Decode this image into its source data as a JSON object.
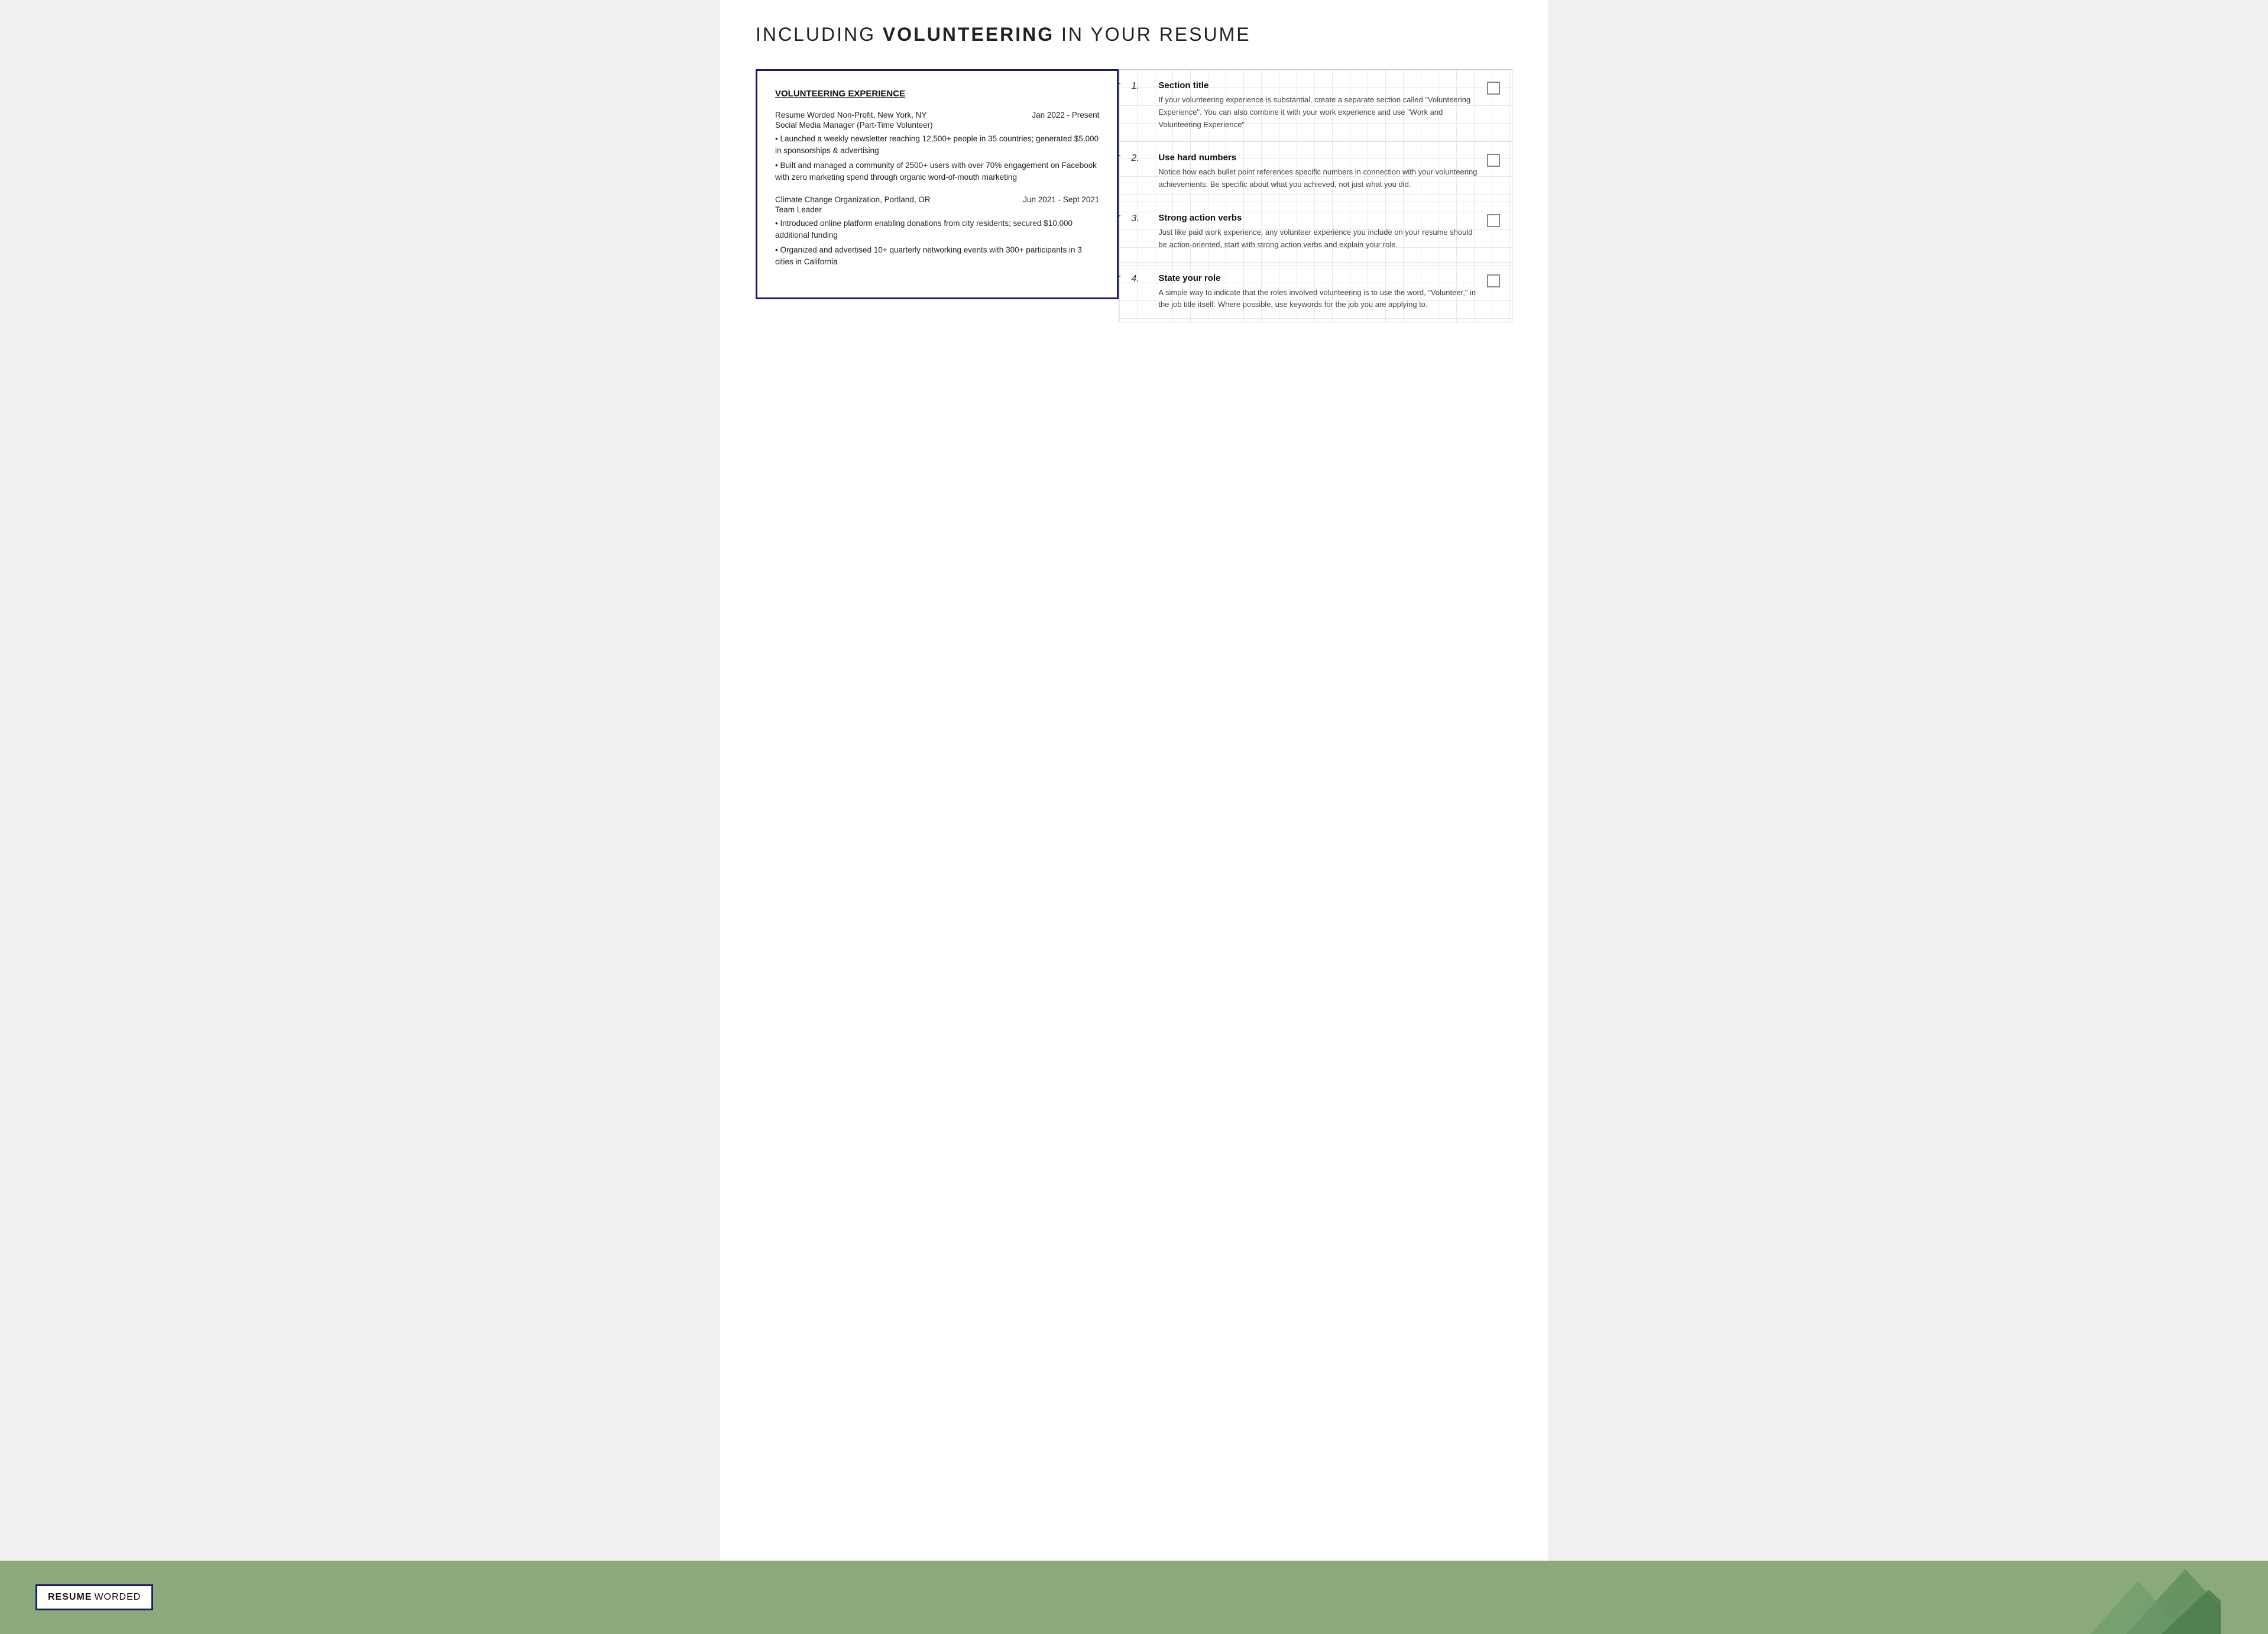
{
  "page": {
    "title_prefix": "INCLUDING ",
    "title_bold": "VOLUNTEERING",
    "title_suffix": " IN YOUR RESUME"
  },
  "resume": {
    "section_title": "VOLUNTEERING EXPERIENCE",
    "entries": [
      {
        "org": "Resume Worded Non-Profit, New York, NY",
        "dates": "Jan 2022 - Present",
        "role": "Social Media Manager (Part-Time Volunteer)",
        "bullets": [
          "• Launched a weekly newsletter reaching 12,500+ people in 35 countries; generated $5,000 in sponsorships & advertising",
          "• Built and managed a community of 2500+ users with over 70% engagement on Facebook with zero marketing spend through organic word-of-mouth marketing"
        ]
      },
      {
        "org": "Climate Change Organization, Portland, OR",
        "dates": "Jun 2021 - Sept 2021",
        "role": "Team Leader",
        "bullets": [
          "• Introduced online platform enabling donations from city residents; secured $10,000 additional funding",
          "• Organized and advertised 10+ quarterly networking events with 300+ participants in 3 cities in California"
        ]
      }
    ]
  },
  "tips": [
    {
      "number": "1.",
      "title": "Section title",
      "description": "If your volunteering experience is substantial, create a separate section called \"Volunteering Experience\". You can also combine it with your work experience and use \"Work and Volunteering Experience\""
    },
    {
      "number": "2.",
      "title": "Use hard numbers",
      "description": "Notice how each bullet point references specific numbers in connection with your volunteering achievements. Be specific about what you achieved, not just what you did."
    },
    {
      "number": "3.",
      "title": "Strong action verbs",
      "description": "Just like paid work experience, any volunteer experience you include on your resume should be action-oriented, start with strong action verbs and explain your role."
    },
    {
      "number": "4.",
      "title": "State your role",
      "description": "A simple way to indicate that the roles involved volunteering is to use the word, \"Volunteer,\" in the job title itself. Where possible, use keywords for the job you are applying to."
    }
  ],
  "logo": {
    "resume_text": "RESUME",
    "worded_text": " WORDED"
  },
  "colors": {
    "dark_blue": "#1a1a6e",
    "green_connector": "#3a8a4a",
    "green_bg": "#8aaa7a"
  }
}
